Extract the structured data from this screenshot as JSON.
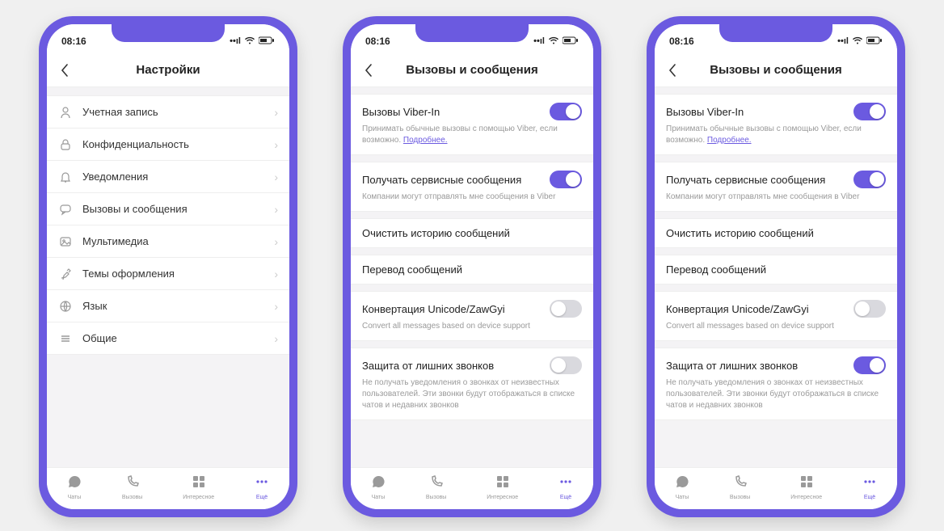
{
  "time": "08:16",
  "phone1": {
    "title": "Настройки",
    "items": [
      {
        "label": "Учетная запись",
        "icon": "user"
      },
      {
        "label": "Конфиденциальность",
        "icon": "lock"
      },
      {
        "label": "Уведомления",
        "icon": "bell"
      },
      {
        "label": "Вызовы и сообщения",
        "icon": "chat"
      },
      {
        "label": "Мультимедиа",
        "icon": "image"
      },
      {
        "label": "Темы оформления",
        "icon": "brush"
      },
      {
        "label": "Язык",
        "icon": "globe"
      },
      {
        "label": "Общие",
        "icon": "menu"
      }
    ]
  },
  "calls_msgs": {
    "title": "Вызовы и сообщения",
    "viber_in": {
      "label": "Вызовы Viber-In",
      "desc": "Принимать обычные вызовы с помощью Viber, если возможно.",
      "more": "Подробнее."
    },
    "service": {
      "label": "Получать сервисные сообщения",
      "desc": "Компании могут отправлять мне сообщения в Viber"
    },
    "clear": {
      "label": "Очистить историю сообщений"
    },
    "translate": {
      "label": "Перевод сообщений"
    },
    "zawgyi": {
      "label": "Конвертация Unicode/ZawGyi",
      "desc": "Convert all messages based on device support"
    },
    "protect": {
      "label": "Защита от лишних звонков",
      "desc": "Не получать уведомления о звонках от неизвестных пользователей. Эти звонки будут отображаться в списке чатов и недавних звонков"
    }
  },
  "tabs": [
    {
      "label": "Чаты",
      "icon": "chats"
    },
    {
      "label": "Вызовы",
      "icon": "calls"
    },
    {
      "label": "Интересное",
      "icon": "discover"
    },
    {
      "label": "Ещё",
      "icon": "more"
    }
  ],
  "phone2_protect_on": false,
  "phone3_protect_on": true
}
